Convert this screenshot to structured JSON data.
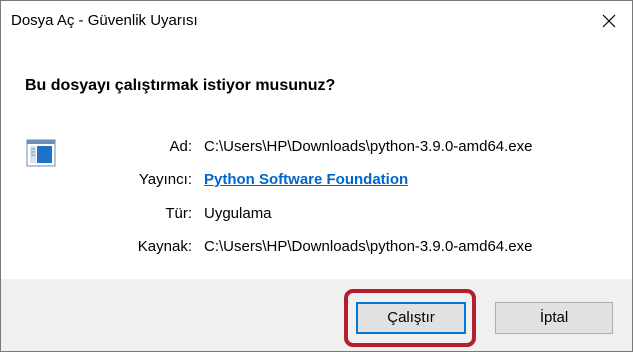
{
  "window": {
    "title": "Dosya Aç - Güvenlik Uyarısı",
    "close_glyph": "✕"
  },
  "dialog": {
    "question": "Bu dosyayı çalıştırmak istiyor musunuz?",
    "icon": "application-window-icon",
    "fields": {
      "name": {
        "label": "Ad:",
        "value": "C:\\Users\\HP\\Downloads\\python-3.9.0-amd64.exe"
      },
      "publisher": {
        "label": "Yayıncı:",
        "value": "Python Software Foundation"
      },
      "type": {
        "label": "Tür:",
        "value": "Uygulama"
      },
      "source": {
        "label": "Kaynak:",
        "value": "C:\\Users\\HP\\Downloads\\python-3.9.0-amd64.exe"
      }
    }
  },
  "buttons": {
    "run_label": "Çalıştır",
    "cancel_label": "İptal"
  },
  "colors": {
    "link": "#0066cc",
    "focus_border": "#0078d7",
    "highlight_annotation": "#b2202b",
    "footer_bg": "#f0f0f0"
  }
}
